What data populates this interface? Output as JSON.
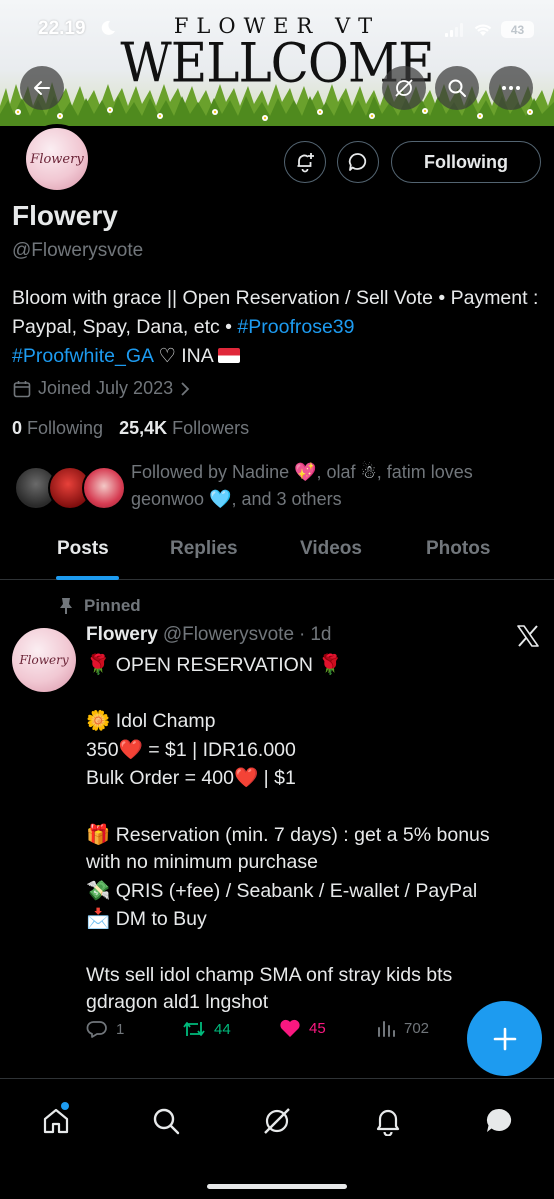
{
  "status_bar": {
    "time": "22.19",
    "battery": "43"
  },
  "banner": {
    "subtitle": "FLOWER VT",
    "title": "WELLCOME"
  },
  "profile": {
    "avatar_text": "Flowery",
    "following_button": "Following",
    "name": "Flowery",
    "handle": "@Flowerysvote",
    "bio_text_1": "Bloom with grace || Open Reservation / Sell Vote • Payment : Paypal, Spay, Dana, etc • ",
    "bio_tag_1": "#Proofrose39",
    "bio_tag_2": "#Proofwhite_GA",
    "bio_text_2": " ♡ INA",
    "joined": "Joined July 2023",
    "following_count": "0",
    "following_label": "Following",
    "followers_count": "25,4K",
    "followers_label": "Followers",
    "followed_by_1": "Followed by Nadine ",
    "followed_by_emoji_1": "💖",
    "followed_by_2": ", olaf ",
    "followed_by_emoji_2": "☃",
    "followed_by_3": ", fatim loves geonwoo ",
    "followed_by_emoji_3": "🩵",
    "followed_by_4": ", and 3 others"
  },
  "tabs": [
    "Posts",
    "Replies",
    "Videos",
    "Photos"
  ],
  "post": {
    "pinned_label": "Pinned",
    "author_name": "Flowery",
    "author_handle": "@Flowerysvote",
    "separator": "·",
    "time": "1d",
    "lines": [
      {
        "emoji": "🌹",
        "text": " OPEN RESERVATION ",
        "emoji_end": "🌹"
      },
      {
        "emoji": "",
        "text": "",
        "emoji_end": ""
      },
      {
        "emoji": "🌼",
        "text": " Idol Champ",
        "emoji_end": ""
      },
      {
        "emoji": "",
        "text": "350",
        "emoji_end": "❤️",
        "tail": " = $1 | IDR16.000"
      },
      {
        "emoji": "",
        "text": "Bulk Order = 400",
        "emoji_end": "❤️",
        "tail": " | $1"
      },
      {
        "emoji": "",
        "text": "",
        "emoji_end": ""
      },
      {
        "emoji": "🎁",
        "text": " Reservation (min. 7 days) : get a 5% bonus",
        "emoji_end": ""
      },
      {
        "emoji": "",
        "text": "with no minimum purchase",
        "emoji_end": ""
      },
      {
        "emoji": "💸",
        "text": " QRIS (+fee) / Seabank / E-wallet / PayPal",
        "emoji_end": ""
      },
      {
        "emoji": "📩",
        "text": " DM to Buy",
        "emoji_end": ""
      },
      {
        "emoji": "",
        "text": "",
        "emoji_end": ""
      },
      {
        "emoji": "",
        "text": "Wts sell idol champ SMA onf stray kids bts",
        "emoji_end": ""
      },
      {
        "emoji": "",
        "text": "gdragon ald1 lngshot",
        "emoji_end": ""
      }
    ],
    "replies": "1",
    "reposts": "44",
    "likes": "45",
    "views": "702"
  },
  "colors": {
    "accent": "#1d9bf0",
    "repost": "#00ba7c",
    "like": "#f91880",
    "muted": "#71767b"
  },
  "icons": [
    "back-arrow-icon",
    "grok-icon",
    "search-icon",
    "more-icon",
    "notify-bell-plus-icon",
    "message-icon",
    "calendar-icon",
    "chevron-right-icon",
    "pin-icon",
    "x-logo-icon",
    "reply-icon",
    "repost-icon",
    "heart-icon",
    "views-icon",
    "plus-icon",
    "home-icon",
    "explore-icon",
    "grok-nav-icon",
    "notifications-icon",
    "messages-icon"
  ]
}
